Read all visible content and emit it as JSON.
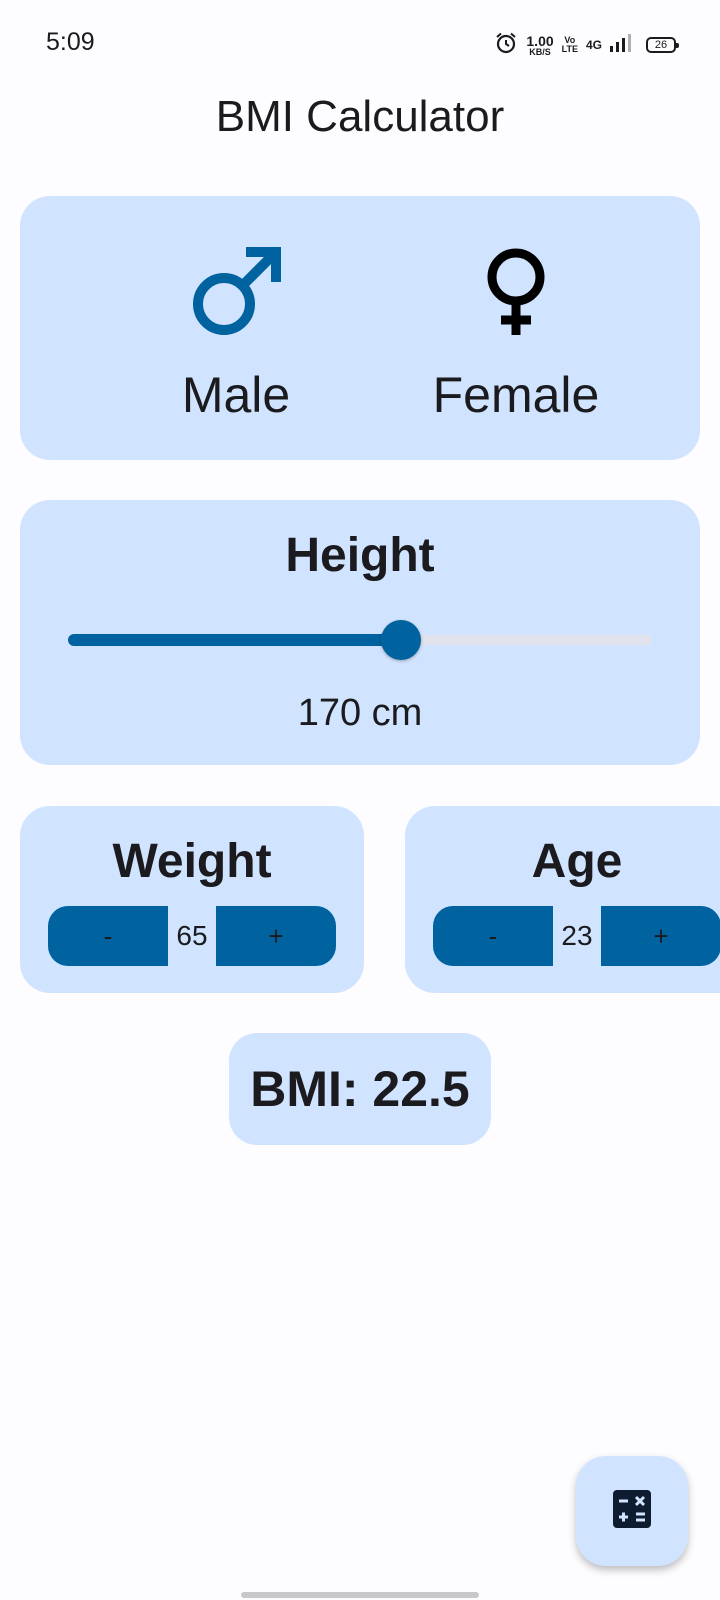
{
  "status_bar": {
    "time": "5:09",
    "net_speed_value": "1.00",
    "net_speed_unit": "KB/S",
    "volte_top": "Vo",
    "volte_bottom": "LTE",
    "network": "4G",
    "battery": "26",
    "icons": [
      "alarm-icon",
      "signal-icon",
      "battery-icon"
    ]
  },
  "app": {
    "title": "BMI Calculator"
  },
  "gender": {
    "male_label": "Male",
    "female_label": "Female",
    "male_symbol": "♂",
    "female_symbol": "♀",
    "male_color": "#00629f",
    "female_color": "#000000"
  },
  "height": {
    "title": "Height",
    "value_text": "170 cm",
    "slider_fraction": 0.57
  },
  "weight": {
    "title": "Weight",
    "minus_label": "-",
    "value": "65",
    "plus_label": "+"
  },
  "age": {
    "title": "Age",
    "minus_label": "-",
    "value": "23",
    "plus_label": "+"
  },
  "result": {
    "bmi_text": "BMI: 22.5"
  },
  "fab": {
    "icon": "calculate-icon"
  },
  "colors": {
    "background": "#fdfcff",
    "card": "#d1e4ff",
    "primary": "#00629f",
    "text": "#1b1b1f"
  }
}
